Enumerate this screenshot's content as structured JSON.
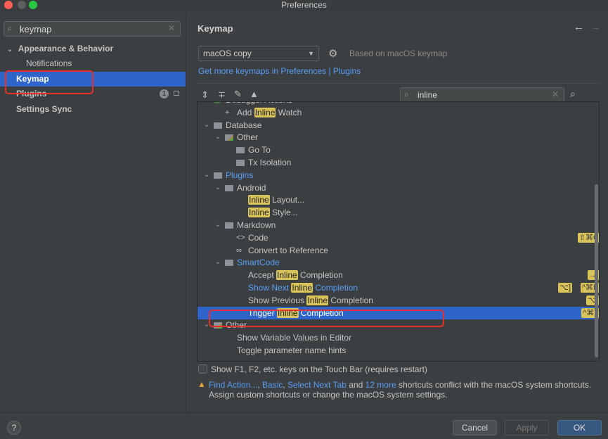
{
  "window": {
    "title": "Preferences"
  },
  "sidebar": {
    "search_value": "keymap",
    "items": [
      {
        "label": "Appearance & Behavior",
        "expanded": true
      },
      {
        "label": "Notifications"
      },
      {
        "label": "Keymap",
        "selected": true
      },
      {
        "label": "Plugins",
        "badge": "1"
      },
      {
        "label": "Settings Sync"
      }
    ]
  },
  "main": {
    "title": "Keymap",
    "keymap_select": "macOS copy",
    "based_on": "Based on macOS keymap",
    "link_text": "Get more keymaps in Preferences | Plugins",
    "filter_value": "inline",
    "highlight_term": "Inline",
    "tree": [
      {
        "label": "Debugger Actions",
        "level": 0,
        "type": "group-green",
        "expanded": true
      },
      {
        "label": "Add Inline Watch",
        "level": 1,
        "type": "action-add"
      },
      {
        "label": "Database",
        "level": 0,
        "type": "folder",
        "expanded": true
      },
      {
        "label": "Other",
        "level": 1,
        "type": "folder-color",
        "expanded": true
      },
      {
        "label": "Go To",
        "level": 2,
        "type": "folder"
      },
      {
        "label": "Tx Isolation",
        "level": 2,
        "type": "folder"
      },
      {
        "label": "Plugins",
        "level": 0,
        "type": "folder",
        "expanded": true,
        "blue": true
      },
      {
        "label": "Android",
        "level": 1,
        "type": "folder",
        "expanded": true
      },
      {
        "label": "Inline Layout...",
        "level": 2,
        "type": "none"
      },
      {
        "label": "Inline Style...",
        "level": 2,
        "type": "none"
      },
      {
        "label": "Markdown",
        "level": 1,
        "type": "folder",
        "expanded": true
      },
      {
        "label": "Code",
        "level": 2,
        "type": "code",
        "shortcuts": [
          "⇧⌘C"
        ]
      },
      {
        "label": "Convert to Reference",
        "level": 2,
        "type": "link"
      },
      {
        "label": "SmartCode",
        "level": 1,
        "type": "folder",
        "expanded": true,
        "blue": true
      },
      {
        "label": "Accept Inline Completion",
        "level": 2,
        "type": "none",
        "shortcuts": [
          "→|"
        ]
      },
      {
        "label": "Show Next Inline Completion",
        "level": 2,
        "type": "none",
        "blue": true,
        "shortcuts": [
          "⌥]",
          "^⌘N"
        ]
      },
      {
        "label": "Show Previous Inline Completion",
        "level": 2,
        "type": "none",
        "shortcuts": [
          "⌥["
        ]
      },
      {
        "label": "Trigger Inline Completion",
        "level": 2,
        "type": "none",
        "selected": true,
        "shortcuts": [
          "^⌘T"
        ]
      },
      {
        "label": "Other",
        "level": 0,
        "type": "folder-color",
        "expanded": true
      },
      {
        "label": "Show Variable Values in Editor",
        "level": 1,
        "type": "none"
      },
      {
        "label": "Toggle parameter name hints",
        "level": 1,
        "type": "none"
      }
    ],
    "touchbar_label": "Show F1, F2, etc. keys on the Touch Bar (requires restart)",
    "warning": {
      "links": [
        "Find Action...",
        "Basic",
        "Select Next Tab"
      ],
      "and": "and",
      "more": "12 more",
      "text": "shortcuts conflict with the macOS system shortcuts.",
      "line2": "Assign custom shortcuts or change the macOS system settings."
    }
  },
  "footer": {
    "help": "?",
    "cancel": "Cancel",
    "apply": "Apply",
    "ok": "OK"
  },
  "colors": {
    "selection": "#2f65ca",
    "highlight": "#d8c25a",
    "link": "#589df6",
    "annotation": "#e8302a"
  }
}
